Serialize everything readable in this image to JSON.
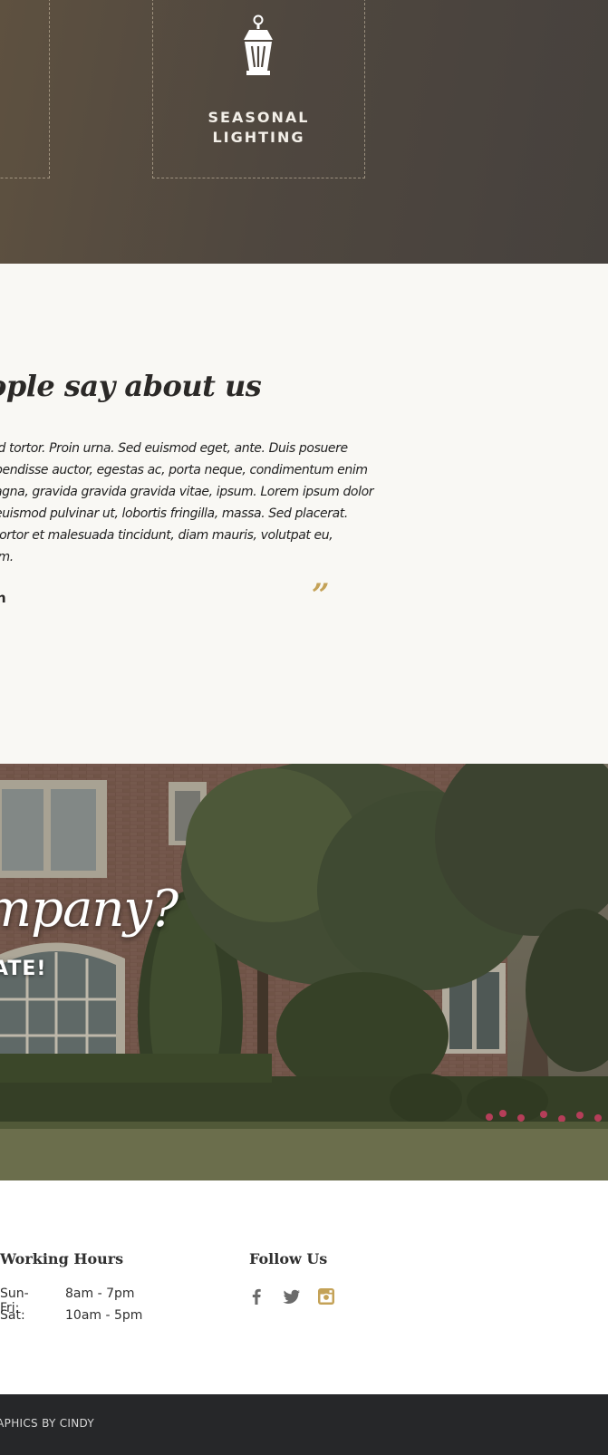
{
  "services": {
    "items": [
      {
        "title": "SEASONAL LIGHTING",
        "icon": "lantern-icon"
      }
    ]
  },
  "testimonial": {
    "heading": "ople say about us",
    "lines": [
      "id tortor. Proin urna. Sed euismod eget, ante. Duis posuere",
      "pendisse auctor, egestas ac, porta neque, condimentum enim",
      "agna, gravida gravida gravida vitae, ipsum. Lorem ipsum dolor",
      "euismod pulvinar ut, lobortis fringilla, massa. Sed placerat.",
      "tortor et malesuada tincidunt, diam mauris, volutpat eu,",
      "im."
    ],
    "author": "n",
    "quote_mark": "”"
  },
  "hero": {
    "question": "mpany?",
    "cta": "ATE!"
  },
  "working_hours": {
    "title": "Working Hours",
    "rows": [
      {
        "day": "Sun-Fri:",
        "time": "8am - 7pm"
      },
      {
        "day": "Sat:",
        "time": "10am - 5pm"
      }
    ]
  },
  "follow_us": {
    "title": "Follow Us",
    "icons": [
      "facebook-icon",
      "twitter-icon",
      "instagram-icon"
    ]
  },
  "footer": {
    "credit": "RAPHICS BY CINDY"
  },
  "colors": {
    "accent": "#c4a257",
    "dark": "#262729",
    "cream": "#f9f8f4",
    "icon_gray": "#6b6b6b"
  }
}
